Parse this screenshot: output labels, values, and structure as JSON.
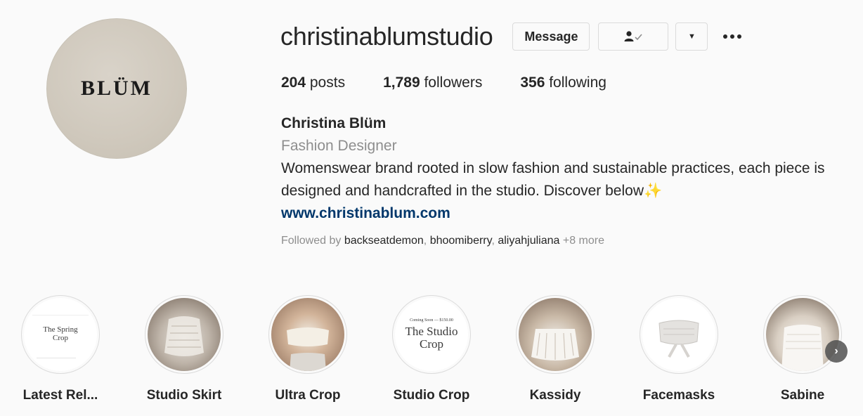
{
  "profile": {
    "avatar_text": "BLÜM",
    "username": "christinablumstudio",
    "buttons": {
      "message": "Message",
      "dropdown": "▼"
    },
    "stats": [
      {
        "count": "204",
        "label": " posts"
      },
      {
        "count": "1,789",
        "label": " followers"
      },
      {
        "count": "356",
        "label": " following"
      }
    ],
    "bio": {
      "name": "Christina Blüm",
      "category": "Fashion Designer",
      "text": "Womenswear brand rooted in slow fashion and sustainable practices, each piece is designed and handcrafted in the studio. Discover below✨",
      "link": "www.christinablum.com"
    },
    "followed_by": {
      "prefix": "Followed by ",
      "names": [
        "backseatdemon",
        "bhoomiberry",
        "aliyahjuliana"
      ],
      "more": "+8 more"
    }
  },
  "highlights": [
    {
      "label": "Latest Rel...",
      "cover_text": "The Spring Crop"
    },
    {
      "label": "Studio Skirt"
    },
    {
      "label": "Ultra Crop"
    },
    {
      "label": "Studio Crop",
      "cover_small": "Coming Soon — $150.00",
      "cover_text": "The Studio Crop"
    },
    {
      "label": "Kassidy"
    },
    {
      "label": "Facemasks"
    },
    {
      "label": "Sabine"
    }
  ],
  "icons": {
    "more": "more-horizontal-icon",
    "following": "person-check-icon",
    "next": "chevron-right-icon"
  },
  "colors": {
    "background": "#fafafa",
    "text": "#262626",
    "secondary": "#8e8e8e",
    "link": "#00376b",
    "border": "#dbdbdb"
  }
}
